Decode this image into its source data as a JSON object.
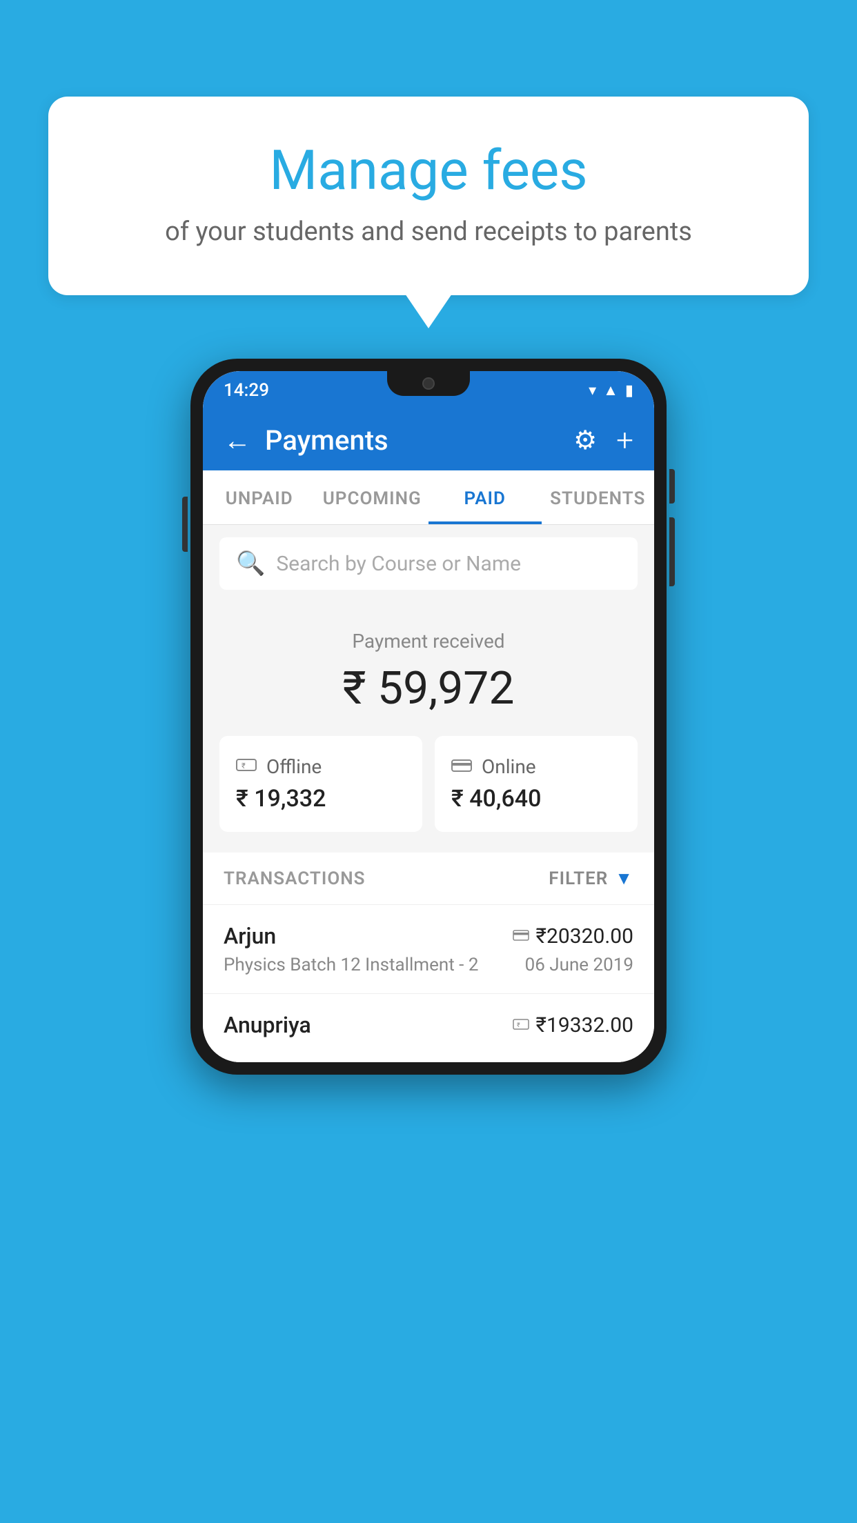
{
  "background_color": "#29ABE2",
  "bubble": {
    "title": "Manage fees",
    "subtitle": "of your students and send receipts to parents"
  },
  "status_bar": {
    "time": "14:29",
    "wifi_icon": "▼",
    "signal_icon": "▲",
    "battery_icon": "▮"
  },
  "app_bar": {
    "title": "Payments",
    "back_label": "←",
    "gear_label": "⚙",
    "plus_label": "+"
  },
  "tabs": [
    {
      "label": "UNPAID",
      "active": false
    },
    {
      "label": "UPCOMING",
      "active": false
    },
    {
      "label": "PAID",
      "active": true
    },
    {
      "label": "STUDENTS",
      "active": false
    }
  ],
  "search": {
    "placeholder": "Search by Course or Name"
  },
  "payment_summary": {
    "label": "Payment received",
    "amount": "₹ 59,972",
    "offline_label": "Offline",
    "offline_amount": "₹ 19,332",
    "online_label": "Online",
    "online_amount": "₹ 40,640"
  },
  "transactions": {
    "header": "TRANSACTIONS",
    "filter_label": "FILTER",
    "items": [
      {
        "name": "Arjun",
        "course": "Physics Batch 12 Installment - 2",
        "amount": "₹20320.00",
        "date": "06 June 2019",
        "payment_type": "card"
      },
      {
        "name": "Anupriya",
        "course": "",
        "amount": "₹19332.00",
        "date": "",
        "payment_type": "offline"
      }
    ]
  }
}
